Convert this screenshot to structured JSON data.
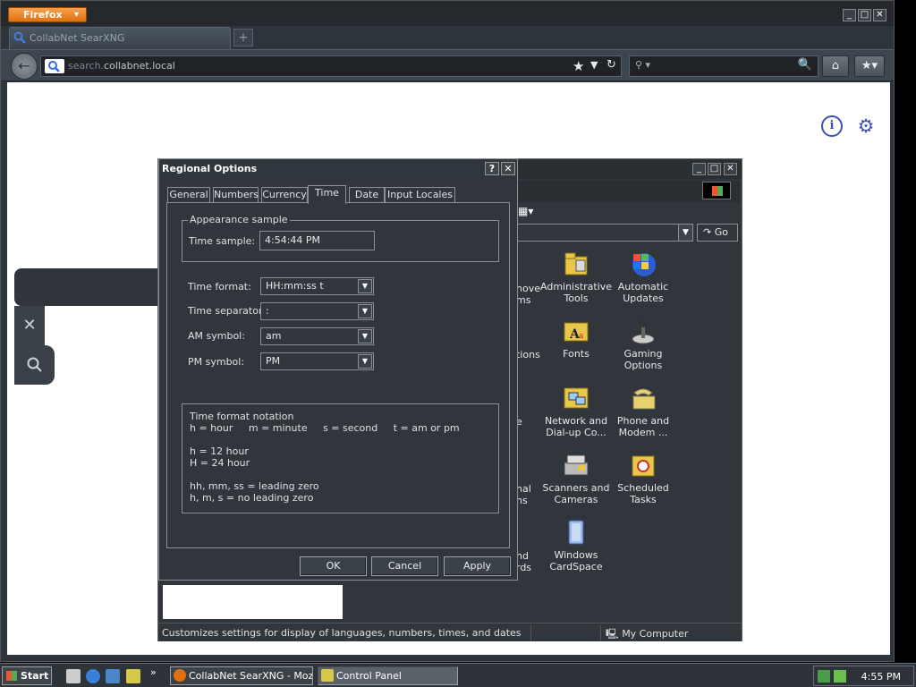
{
  "browser": {
    "menu_label": "Firefox",
    "tab_title": "CollabNet SearXNG",
    "url_prefix": "search.",
    "url_domain": "collabnet.local"
  },
  "control_panel": {
    "go_label": "Go",
    "items": [
      {
        "label1": "Administrative",
        "label2": "Tools",
        "icon": "admin-tools-icon"
      },
      {
        "label1": "Automatic",
        "label2": "Updates",
        "icon": "automatic-updates-icon"
      },
      {
        "label1": "Fonts",
        "label2": "",
        "icon": "fonts-icon"
      },
      {
        "label1": "Gaming",
        "label2": "Options",
        "icon": "gaming-options-icon"
      },
      {
        "label1": "Network and",
        "label2": "Dial-up Co...",
        "icon": "network-icon"
      },
      {
        "label1": "Phone and",
        "label2": "Modem ...",
        "icon": "phone-modem-icon"
      },
      {
        "label1": "Scanners and",
        "label2": "Cameras",
        "icon": "scanners-icon"
      },
      {
        "label1": "Scheduled",
        "label2": "Tasks",
        "icon": "scheduled-tasks-icon"
      },
      {
        "label1": "Windows",
        "label2": "CardSpace",
        "icon": "cardspace-icon"
      }
    ],
    "partial_items": [
      {
        "line1": "nove",
        "line2": "ms"
      },
      {
        "line1": "tions",
        "line2": ""
      },
      {
        "line1": "e",
        "line2": ""
      },
      {
        "line1": "nal",
        "line2": "ns"
      },
      {
        "line1": "nd",
        "line2": "rds"
      }
    ],
    "status_text": "Customizes settings for display of languages, numbers, times, and dates",
    "status_zone": "My Computer"
  },
  "dialog": {
    "title": "Regional Options",
    "help_btn": "?",
    "close_btn": "✕",
    "tabs": [
      "General",
      "Numbers",
      "Currency",
      "Time",
      "Date",
      "Input Locales"
    ],
    "active_tab": "Time",
    "appearance_legend": "Appearance sample",
    "time_sample_label": "Time sample:",
    "time_sample_value": "4:54:44 PM",
    "time_format_label": "Time format:",
    "time_format_value": "HH:mm:ss t",
    "time_separator_label": "Time separator:",
    "time_separator_value": ":",
    "am_label": "AM symbol:",
    "am_value": "am",
    "pm_label": "PM symbol:",
    "pm_value": "PM",
    "notation": {
      "title": "Time format notation",
      "line1": "h = hour     m = minute     s = second     t = am or pm",
      "line2": "h = 12 hour",
      "line3": "H = 24 hour",
      "line4": "hh, mm, ss = leading zero",
      "line5": "h, m, s = no leading zero"
    },
    "ok": "OK",
    "cancel": "Cancel",
    "apply": "Apply"
  },
  "taskbar": {
    "start": "Start",
    "task1": "CollabNet SearXNG - Mozil...",
    "task2": "Control Panel",
    "clock": "4:55 PM",
    "more": "»"
  },
  "colors": {
    "accent": "#3f51b5",
    "firefox_orange": "#e0700f"
  }
}
